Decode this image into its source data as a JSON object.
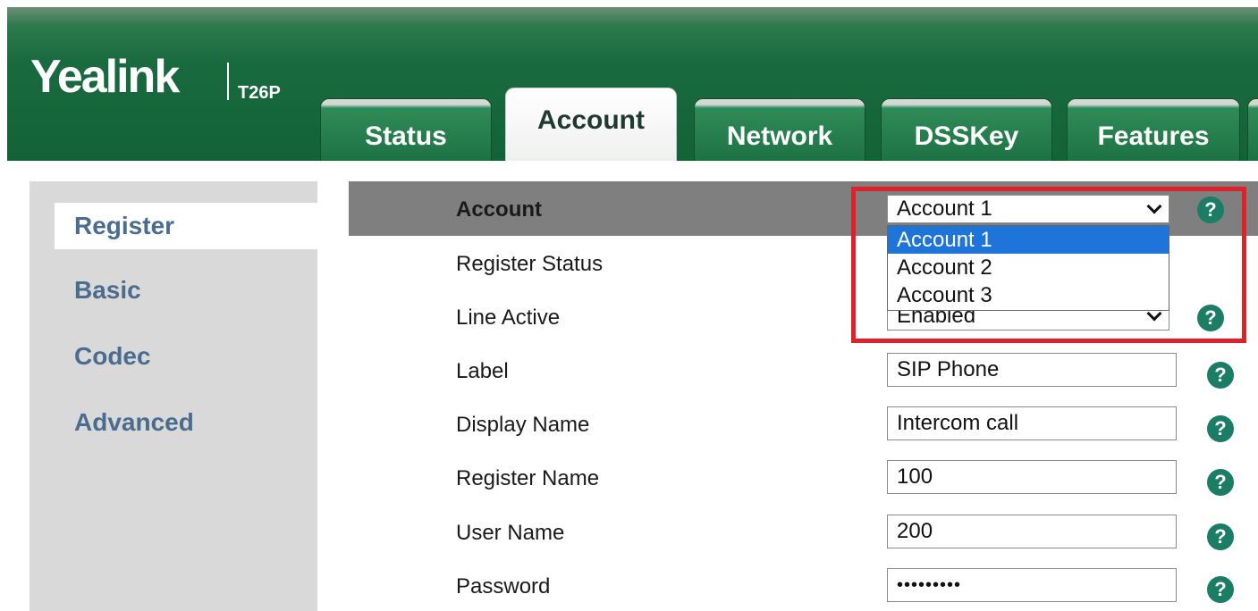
{
  "brand": {
    "name": "Yealink",
    "model": "T26P"
  },
  "tabs": [
    {
      "label": "Status",
      "active": false
    },
    {
      "label": "Account",
      "active": true
    },
    {
      "label": "Network",
      "active": false
    },
    {
      "label": "DSSKey",
      "active": false
    },
    {
      "label": "Features",
      "active": false
    }
  ],
  "sidebar": {
    "items": [
      {
        "label": "Register",
        "active": true
      },
      {
        "label": "Basic",
        "active": false
      },
      {
        "label": "Codec",
        "active": false
      },
      {
        "label": "Advanced",
        "active": false
      }
    ]
  },
  "form": {
    "account": {
      "label": "Account",
      "value": "Account 1",
      "options": [
        "Account 1",
        "Account 2",
        "Account 3"
      ],
      "highlighted_option": "Account 1"
    },
    "register_status": {
      "label": "Register Status"
    },
    "line_active": {
      "label": "Line Active",
      "value": "Enabled"
    },
    "label_field": {
      "label": "Label",
      "value": "SIP Phone"
    },
    "display_name": {
      "label": "Display Name",
      "value": "Intercom call"
    },
    "register_name": {
      "label": "Register Name",
      "value": "100"
    },
    "user_name": {
      "label": "User Name",
      "value": "200"
    },
    "password": {
      "label": "Password",
      "value": "•••••••••"
    }
  },
  "help_glyph": "?",
  "colors": {
    "header_green": "#1a6a40",
    "help_icon": "#1b7d66",
    "sidebar_text": "#4a6d8f",
    "highlight_box": "#e0202a",
    "dropdown_selected": "#1e74d8"
  }
}
